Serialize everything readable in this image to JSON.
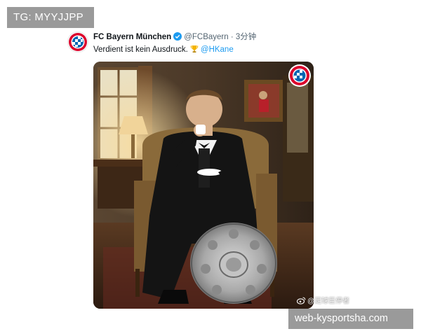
{
  "overlay": {
    "top_left_text": "TG: MYYJJPP",
    "bottom_right_text": "web-kysportsha.com"
  },
  "tweet": {
    "author_name": "FC Bayern München",
    "handle": "@FCBayern",
    "separator": "·",
    "time_ago": "3分钟",
    "text": "Verdient ist kein Ausdruck.",
    "mention": "@HKane",
    "avatar_icon": "fc-bayern-logo-icon",
    "verified_icon": "verified-badge-icon",
    "emoji_icon": "trophy-icon"
  },
  "image": {
    "alt_subject": "Harry Kane seated in armchair in tuxedo holding espresso cup beside Bundesliga Meisterschale trophy",
    "corner_logo": "fc-bayern-logo-icon",
    "watermark_text": "@足球巨停者"
  },
  "colors": {
    "name": "#0f1419",
    "secondary": "#536471",
    "link": "#1d9bf0",
    "label_bg": "#9a9a9a",
    "bayern_red": "#dc052d",
    "bayern_blue": "#0066b2"
  }
}
